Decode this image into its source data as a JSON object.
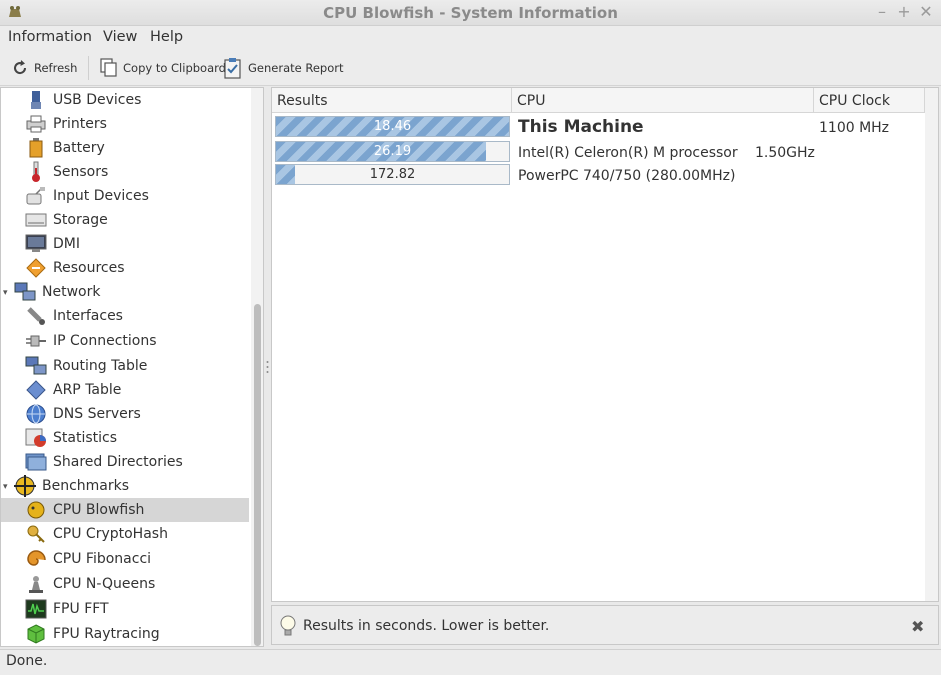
{
  "window": {
    "title": "CPU Blowfish - System Information"
  },
  "menu": [
    "Information",
    "View",
    "Help"
  ],
  "toolbar": {
    "refresh": "Refresh",
    "copy": "Copy to Clipboard",
    "report": "Generate Report"
  },
  "sidebar": {
    "items": [
      {
        "label": "USB Devices",
        "icon": "usb-icon"
      },
      {
        "label": "Printers",
        "icon": "printer-icon"
      },
      {
        "label": "Battery",
        "icon": "battery-icon"
      },
      {
        "label": "Sensors",
        "icon": "thermometer-icon"
      },
      {
        "label": "Input Devices",
        "icon": "input-devices-icon"
      },
      {
        "label": "Storage",
        "icon": "storage-icon"
      },
      {
        "label": "DMI",
        "icon": "monitor-icon"
      },
      {
        "label": "Resources",
        "icon": "resources-icon"
      },
      {
        "label": "Network",
        "icon": "network-icon"
      },
      {
        "label": "Interfaces",
        "icon": "interfaces-icon"
      },
      {
        "label": "IP Connections",
        "icon": "plug-icon"
      },
      {
        "label": "Routing Table",
        "icon": "routing-icon"
      },
      {
        "label": "ARP Table",
        "icon": "arp-icon"
      },
      {
        "label": "DNS Servers",
        "icon": "globe-icon"
      },
      {
        "label": "Statistics",
        "icon": "statistics-icon"
      },
      {
        "label": "Shared Directories",
        "icon": "folder-icon"
      },
      {
        "label": "Benchmarks",
        "icon": "benchmarks-icon"
      },
      {
        "label": "CPU Blowfish",
        "icon": "blowfish-icon"
      },
      {
        "label": "CPU CryptoHash",
        "icon": "keys-icon"
      },
      {
        "label": "CPU Fibonacci",
        "icon": "shell-icon"
      },
      {
        "label": "CPU N-Queens",
        "icon": "chess-icon"
      },
      {
        "label": "FPU FFT",
        "icon": "fft-icon"
      },
      {
        "label": "FPU Raytracing",
        "icon": "cube-icon"
      }
    ]
  },
  "table": {
    "headers": [
      "Results",
      "CPU",
      "CPU Clock"
    ],
    "rows": [
      {
        "result": "18.46",
        "fraction": 1.0,
        "cpu": "This Machine",
        "clock": "1100 MHz"
      },
      {
        "result": "26.19",
        "fraction": 0.9,
        "cpu": "Intel(R) Celeron(R) M processor",
        "clock": "1.50GHz"
      },
      {
        "result": "172.82",
        "fraction": 0.08,
        "cpu": "PowerPC 740/750 (280.00MHz)",
        "clock": ""
      }
    ]
  },
  "info": {
    "message": "Results in seconds. Lower is better."
  },
  "status": "Done."
}
